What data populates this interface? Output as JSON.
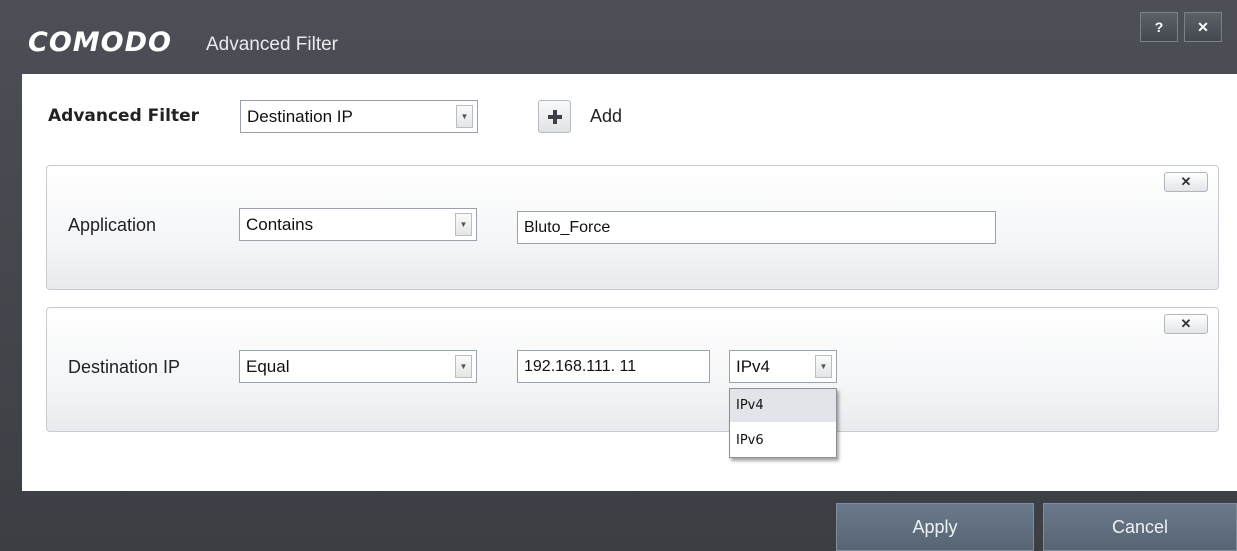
{
  "window": {
    "brand": "COMODO",
    "title": "Advanced Filter",
    "help_label": "?",
    "close_label": "✕"
  },
  "filter": {
    "label": "Advanced Filter",
    "selected": "Destination IP",
    "add_label": "Add"
  },
  "rules": [
    {
      "label": "Application",
      "operator": "Contains",
      "value": "Bluto_Force",
      "remove_label": "✕"
    },
    {
      "label": "Destination IP",
      "operator": "Equal",
      "value": "192.168.111.  11",
      "ip_version": "IPv4",
      "remove_label": "✕"
    }
  ],
  "ip_version_options": [
    "IPv4",
    "IPv6"
  ],
  "ip_version_highlighted": "IPv4",
  "footer": {
    "apply_label": "Apply",
    "cancel_label": "Cancel"
  },
  "icons": {
    "dropdown_arrow": "chevron-down-icon",
    "add": "plus-icon",
    "close": "close-icon",
    "help": "help-icon"
  },
  "colors": {
    "titlebar_bg": "#45494f",
    "button_bg": "#60707f",
    "content_bg": "#ffffff"
  }
}
